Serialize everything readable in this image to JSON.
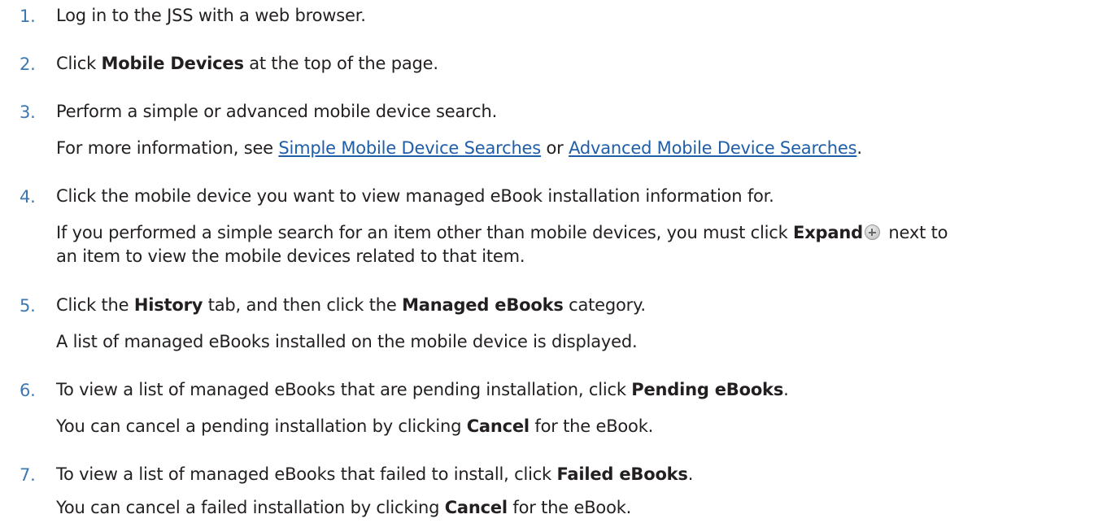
{
  "steps": [
    {
      "num": "1.",
      "t1": "Log in to the JSS with a web browser."
    },
    {
      "num": "2.",
      "t1": "Click ",
      "b1": "Mobile Devices",
      "t2": " at the top of the page."
    },
    {
      "num": "3.",
      "t1": "Perform a simple or advanced mobile device search.",
      "n1": "For more information, see ",
      "link1": "Simple Mobile Device Searches",
      "n2": " or ",
      "link2": "Advanced Mobile Device Searches",
      "n3": "."
    },
    {
      "num": "4.",
      "t1": "Click the mobile device you want to view managed eBook installation information for.",
      "n1": "If you performed a simple search for an item other than mobile devices, you must click ",
      "b1": "Expand",
      "icon": "plus-circle-icon",
      "n2": " next to",
      "n3": "an item to view the mobile devices related to that item."
    },
    {
      "num": "5.",
      "t1": "Click the ",
      "b1": "History",
      "t2": " tab, and then click the ",
      "b2": "Managed eBooks",
      "t3": " category.",
      "n1": "A list of managed eBooks installed on the mobile device is displayed."
    },
    {
      "num": "6.",
      "t1": "To view a list of managed eBooks that are pending installation, click ",
      "b1": "Pending eBooks",
      "t2": ".",
      "n1": "You can cancel a pending installation by clicking ",
      "b2": "Cancel",
      "n2": " for the eBook."
    },
    {
      "num": "7.",
      "t1": "To view a list of managed eBooks that failed to install, click ",
      "b1": "Failed eBooks",
      "t2": ".",
      "n1": "You can cancel a failed installation by clicking ",
      "b2": "Cancel",
      "n2": " for the eBook."
    }
  ]
}
